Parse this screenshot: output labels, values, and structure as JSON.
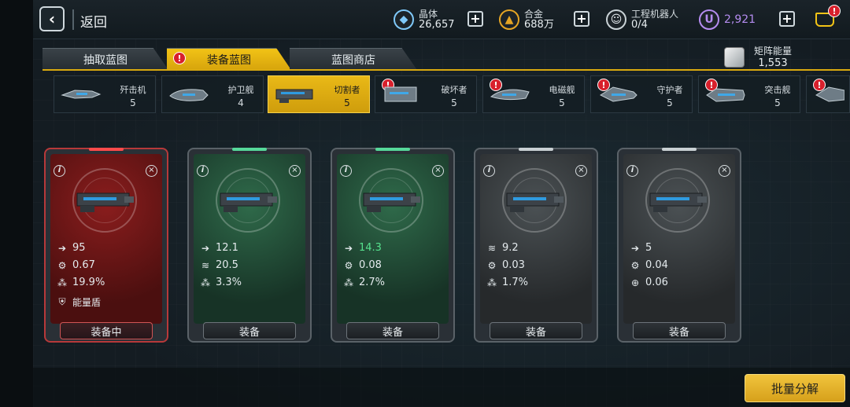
{
  "header": {
    "back_label": "返回",
    "resources": [
      {
        "name": "晶体",
        "value": "26,657",
        "icon": "crystal-icon",
        "color": "#7fc8f8"
      },
      {
        "name": "合金",
        "value": "688万",
        "icon": "alloy-icon",
        "color": "#e5a524"
      },
      {
        "name": "工程机器人",
        "value": "0/4",
        "icon": "robot-icon",
        "color": "#d6dde1"
      }
    ],
    "currency": {
      "icon_letter": "U",
      "value": "2,921",
      "color": "#b58cf0"
    },
    "cart_badge": "!"
  },
  "tabs": [
    {
      "label": "抽取蓝图",
      "active": false,
      "badge": ""
    },
    {
      "label": "装备蓝图",
      "active": true,
      "badge": "!"
    },
    {
      "label": "蓝图商店",
      "active": false,
      "badge": ""
    }
  ],
  "matrix_energy": {
    "label": "矩阵能量",
    "value": "1,553"
  },
  "ships": [
    {
      "name": "歼击机",
      "count": "5",
      "badge": ""
    },
    {
      "name": "护卫舰",
      "count": "4",
      "badge": ""
    },
    {
      "name": "切割者",
      "count": "5",
      "badge": "!",
      "active": true
    },
    {
      "name": "破坏者",
      "count": "5",
      "badge": "!"
    },
    {
      "name": "电磁舰",
      "count": "5",
      "badge": "!"
    },
    {
      "name": "守护者",
      "count": "5",
      "badge": "!"
    },
    {
      "name": "突击舰",
      "count": "5",
      "badge": "!"
    },
    {
      "name": "",
      "count": "",
      "badge": "!"
    }
  ],
  "cards": [
    {
      "tier": "red",
      "button": "装备中",
      "stats": [
        {
          "icon": "arrow-icon",
          "value": "95"
        },
        {
          "icon": "gear-icon",
          "value": "0.67"
        },
        {
          "icon": "spread-icon",
          "value": "19.9%"
        },
        {
          "icon": "shield-icon",
          "value": "能量盾"
        }
      ]
    },
    {
      "tier": "green",
      "button": "装备",
      "stats": [
        {
          "icon": "arrow-icon",
          "value": "12.1"
        },
        {
          "icon": "wave-icon",
          "value": "20.5"
        },
        {
          "icon": "spread-icon",
          "value": "3.3%"
        }
      ]
    },
    {
      "tier": "green",
      "button": "装备",
      "stats": [
        {
          "icon": "arrow-icon",
          "value": "14.3",
          "highlight": true
        },
        {
          "icon": "gear-icon",
          "value": "0.08"
        },
        {
          "icon": "spread-icon",
          "value": "2.7%"
        }
      ]
    },
    {
      "tier": "gray",
      "button": "装备",
      "stats": [
        {
          "icon": "wave-icon",
          "value": "9.2"
        },
        {
          "icon": "gear-icon",
          "value": "0.03"
        },
        {
          "icon": "spread-icon",
          "value": "1.7%"
        }
      ]
    },
    {
      "tier": "gray",
      "button": "装备",
      "stats": [
        {
          "icon": "arrow-icon",
          "value": "5"
        },
        {
          "icon": "gear-icon",
          "value": "0.04"
        },
        {
          "icon": "crosshair-icon",
          "value": "0.06"
        }
      ]
    }
  ],
  "bulk_button": "批量分解"
}
